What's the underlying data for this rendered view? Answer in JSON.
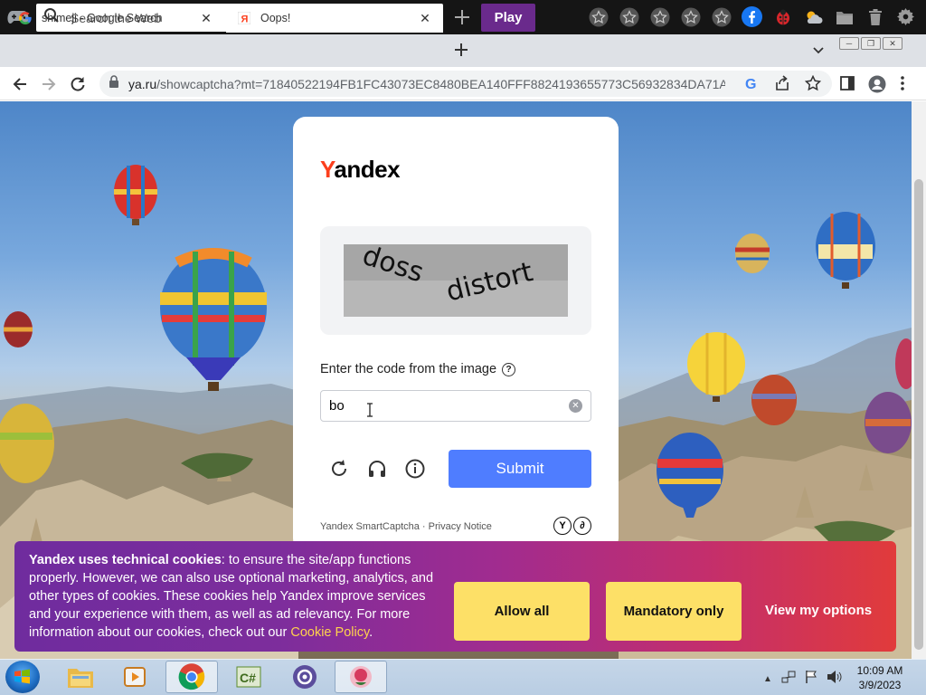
{
  "toolbar": {
    "search_placeholder": "Search the Web",
    "play_label": "Play"
  },
  "tabs": [
    {
      "title": "shimeji - Google Search",
      "favicon": "google-icon"
    },
    {
      "title": "Oops!",
      "favicon": "yandex-icon"
    }
  ],
  "address": {
    "url_host": "ya.ru",
    "url_path": "/showcaptcha?mt=71840522194FB1FC43073EC8480BEA140FFF8824193655773C56932834DA71AA7A..."
  },
  "captcha": {
    "logo_first": "Y",
    "logo_rest": "andex",
    "image_words": [
      "doss",
      "distort"
    ],
    "prompt": "Enter the code from the image",
    "input_value": "bo",
    "submit_label": "Submit",
    "footer_text": "Yandex SmartCaptcha · Privacy Notice"
  },
  "cookie_banner": {
    "bold_lead": "Yandex uses technical cookies",
    "body": ": to ensure the site/app functions properly. However, we can also use optional marketing, analytics, and other types of cookies. These cookies help Yandex improve services and your experience with them, as well as ad relevancy. For more information about our cookies, check out our ",
    "link_text": "Cookie Policy",
    "trail": ".",
    "allow_all": "Allow all",
    "mandatory_only": "Mandatory only",
    "view_options": "View my options"
  },
  "taskbar": {
    "time": "10:09 AM",
    "date": "3/9/2023"
  },
  "colors": {
    "yandex_red": "#fc3f1d",
    "submit_blue": "#4f7dff",
    "cookie_button": "#fde067",
    "play_purple": "#6a2a8c"
  }
}
